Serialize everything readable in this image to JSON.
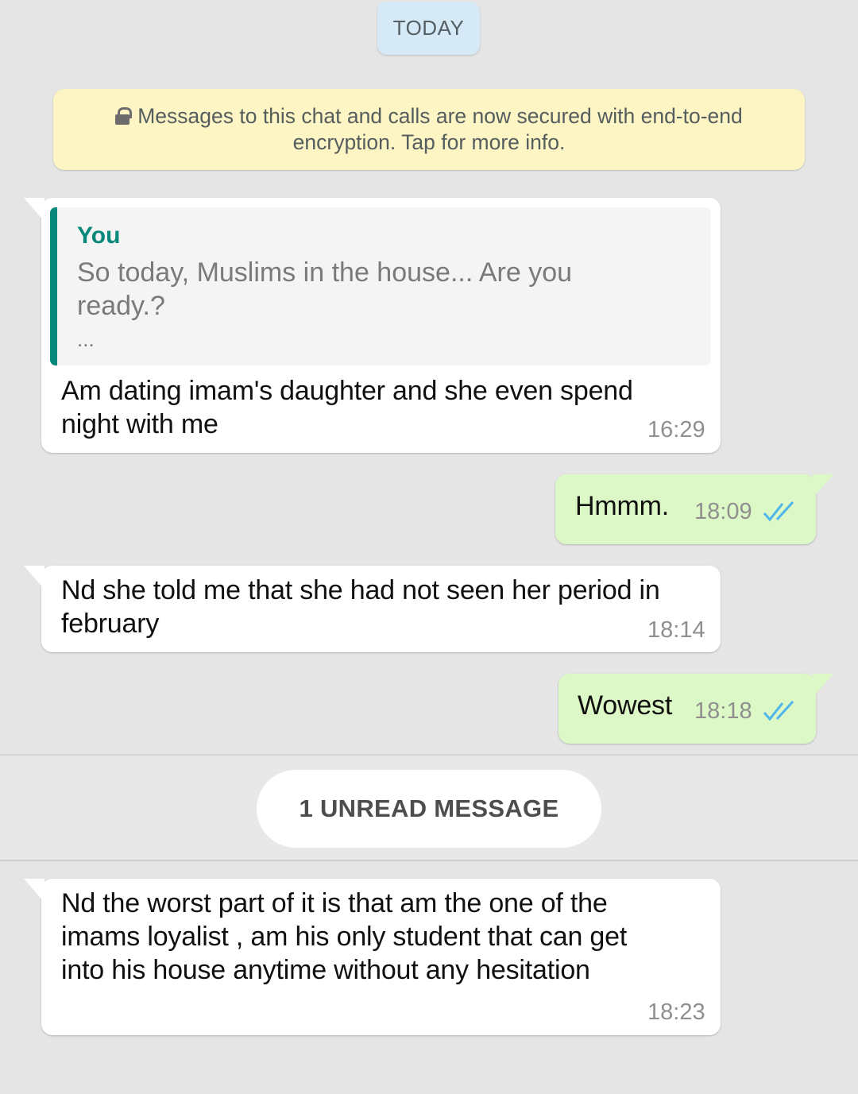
{
  "date_divider": "TODAY",
  "encryption_notice": {
    "icon": "lock-icon",
    "line1": "Messages to this chat and calls are now secured with end-to-end",
    "line2": "encryption. Tap for more info."
  },
  "messages": [
    {
      "direction": "incoming",
      "quote": {
        "author": "You",
        "line1": "So today, Muslims in the house... Are you",
        "line2": "ready.?",
        "more": "..."
      },
      "line1": "Am dating imam's daughter and she even spend",
      "line2": "night with me",
      "time": "16:29"
    },
    {
      "direction": "outgoing",
      "line1": "Hmmm.",
      "time": "18:09",
      "status": "read"
    },
    {
      "direction": "incoming",
      "line1": "Nd she told me that she had not seen her period in",
      "line2": "february",
      "time": "18:14"
    },
    {
      "direction": "outgoing",
      "line1": "Wowest",
      "time": "18:18",
      "status": "read"
    },
    {
      "direction": "incoming",
      "line1": "Nd the worst part of it is that am the one of the",
      "line2": "imams loyalist , am his only student that can get",
      "line3": "into his house anytime without any hesitation",
      "time": "18:23"
    }
  ],
  "unread_divider": "1 UNREAD MESSAGE",
  "colors": {
    "background": "#e5e5e5",
    "incoming_bubble": "#ffffff",
    "outgoing_bubble": "#dcf8c6",
    "quote_accent": "#07887b",
    "read_ticks": "#4fb6ec",
    "encryption_banner": "#fdf5c4",
    "date_pill": "#d5eaf6"
  }
}
